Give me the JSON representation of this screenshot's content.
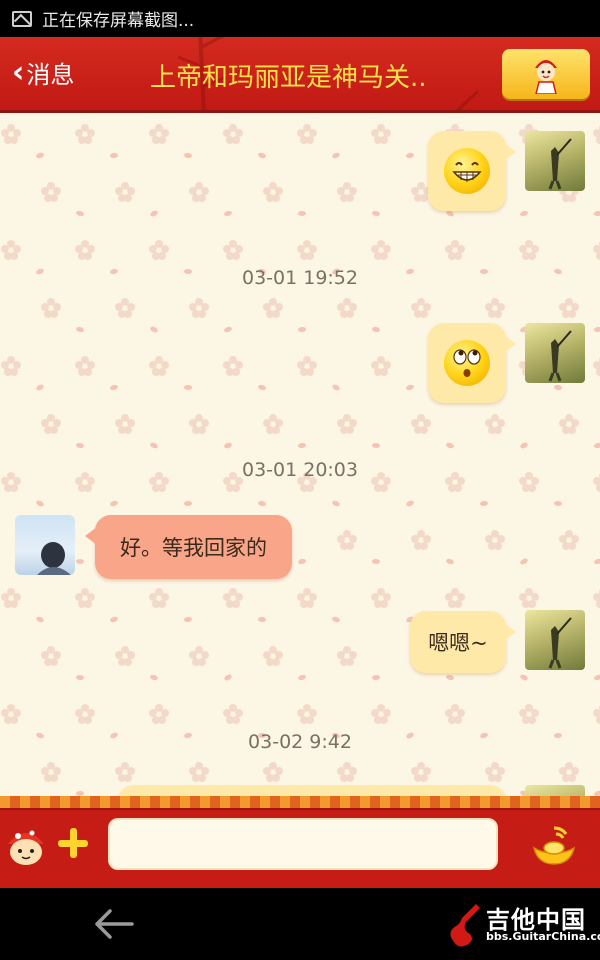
{
  "status_bar": {
    "text": "正在保存屏幕截图..."
  },
  "header": {
    "back_label": "消息",
    "title": "上帝和玛丽亚是神马关..",
    "profile_icon": "profile-avatar-icon"
  },
  "messages": [
    {
      "type": "sent",
      "content": "grinning-emoji"
    },
    {
      "type": "timestamp",
      "text": "03-01 19:52"
    },
    {
      "type": "sent",
      "content": "eyes-rolling-emoji"
    },
    {
      "type": "timestamp",
      "text": "03-01 20:03"
    },
    {
      "type": "received",
      "text": "好。等我回家的"
    },
    {
      "type": "sent",
      "text": "嗯嗯~"
    },
    {
      "type": "timestamp",
      "text": "03-02 9:42"
    }
  ],
  "input_bar": {
    "input_value": "",
    "icons": [
      "mascot-icon",
      "plus-icon",
      "gold-ingot-icon"
    ]
  },
  "nav_bar": {
    "back_icon": "back-arrow-icon",
    "watermark_title": "吉他中国",
    "watermark_url": "bbs.GuitarChina.com"
  },
  "colors": {
    "header_red": "#d42a1f",
    "title_yellow": "#ffe14a",
    "chat_bg": "#fcf6e5",
    "bubble_me": "#ffe9a9",
    "bubble_friend": "#f9a589"
  }
}
